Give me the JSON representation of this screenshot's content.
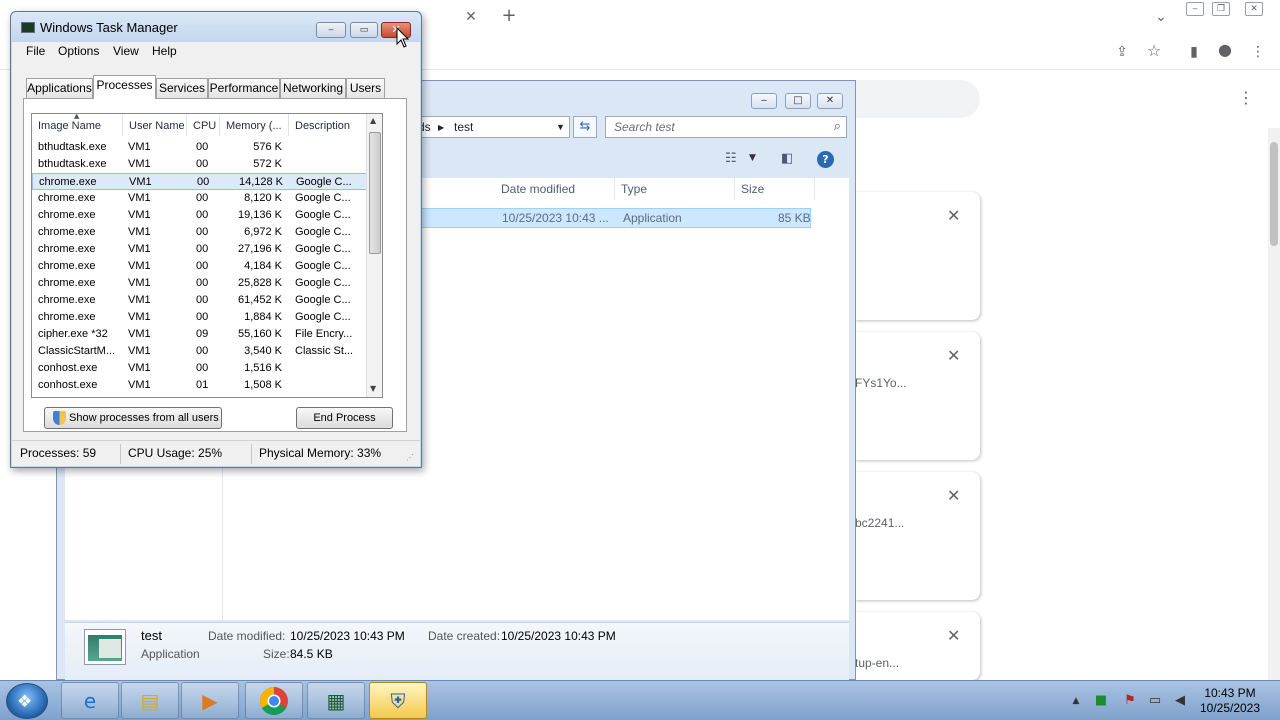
{
  "chrome": {
    "tab_close_glyph": "✕",
    "new_tab_glyph": "+",
    "menu_glyph": "⋮",
    "download_cards": [
      {
        "close": "✕",
        "text": ""
      },
      {
        "close": "✕",
        "text": "FYs1Yo..."
      },
      {
        "close": "✕",
        "text": "bc2241..."
      },
      {
        "close": "✕",
        "text": "tup-en..."
      }
    ]
  },
  "explorer": {
    "breadcrumb_prev": "ds",
    "breadcrumb_current": "test",
    "search_placeholder": "Search test",
    "columns": [
      "Date modified",
      "Type",
      "Size"
    ],
    "file_row": {
      "date": "10/25/2023 10:43 ...",
      "type": "Application",
      "size": "85 KB"
    },
    "details": {
      "name": "test",
      "kind": "Application",
      "date_modified_label": "Date modified:",
      "date_modified": "10/25/2023 10:43 PM",
      "date_created_label": "Date created:",
      "date_created": "10/25/2023 10:43 PM",
      "size_label": "Size:",
      "size": "84.5 KB"
    }
  },
  "task_manager": {
    "title": "Windows Task Manager",
    "menu": [
      "File",
      "Options",
      "View",
      "Help"
    ],
    "tabs": [
      "Applications",
      "Processes",
      "Services",
      "Performance",
      "Networking",
      "Users"
    ],
    "active_tab": "Processes",
    "columns": [
      "Image Name",
      "User Name",
      "CPU",
      "Memory (...",
      "Description"
    ],
    "processes": [
      {
        "name": "bthudtask.exe",
        "user": "VM1",
        "cpu": "00",
        "mem": "576 K",
        "desc": ""
      },
      {
        "name": "bthudtask.exe",
        "user": "VM1",
        "cpu": "00",
        "mem": "572 K",
        "desc": ""
      },
      {
        "name": "chrome.exe",
        "user": "VM1",
        "cpu": "00",
        "mem": "14,128 K",
        "desc": "Google C..."
      },
      {
        "name": "chrome.exe",
        "user": "VM1",
        "cpu": "00",
        "mem": "8,120 K",
        "desc": "Google C..."
      },
      {
        "name": "chrome.exe",
        "user": "VM1",
        "cpu": "00",
        "mem": "19,136 K",
        "desc": "Google C..."
      },
      {
        "name": "chrome.exe",
        "user": "VM1",
        "cpu": "00",
        "mem": "6,972 K",
        "desc": "Google C..."
      },
      {
        "name": "chrome.exe",
        "user": "VM1",
        "cpu": "00",
        "mem": "27,196 K",
        "desc": "Google C..."
      },
      {
        "name": "chrome.exe",
        "user": "VM1",
        "cpu": "00",
        "mem": "4,184 K",
        "desc": "Google C..."
      },
      {
        "name": "chrome.exe",
        "user": "VM1",
        "cpu": "00",
        "mem": "25,828 K",
        "desc": "Google C..."
      },
      {
        "name": "chrome.exe",
        "user": "VM1",
        "cpu": "00",
        "mem": "61,452 K",
        "desc": "Google C..."
      },
      {
        "name": "chrome.exe",
        "user": "VM1",
        "cpu": "00",
        "mem": "1,884 K",
        "desc": "Google C..."
      },
      {
        "name": "cipher.exe *32",
        "user": "VM1",
        "cpu": "09",
        "mem": "55,160 K",
        "desc": "File Encry..."
      },
      {
        "name": "ClassicStartM...",
        "user": "VM1",
        "cpu": "00",
        "mem": "3,540 K",
        "desc": "Classic St..."
      },
      {
        "name": "conhost.exe",
        "user": "VM1",
        "cpu": "00",
        "mem": "1,516 K",
        "desc": ""
      },
      {
        "name": "conhost.exe",
        "user": "VM1",
        "cpu": "01",
        "mem": "1,508 K",
        "desc": ""
      }
    ],
    "selected_row": 2,
    "show_all_button": "Show processes from all users",
    "end_process_button": "End Process",
    "status": {
      "processes": "Processes: 59",
      "cpu": "CPU Usage: 25%",
      "memory": "Physical Memory: 33%"
    }
  },
  "taskbar": {
    "clock_time": "10:43 PM",
    "clock_date": "10/25/2023",
    "icons": [
      "start-orb-icon",
      "internet-explorer-icon",
      "file-explorer-icon",
      "media-player-icon",
      "chrome-icon",
      "task-manager-icon",
      "security-shield-icon"
    ]
  },
  "colors": {
    "selection": "#cce8ff",
    "taskbar": "#a9c3e3",
    "close_button": "#c44a2e"
  }
}
